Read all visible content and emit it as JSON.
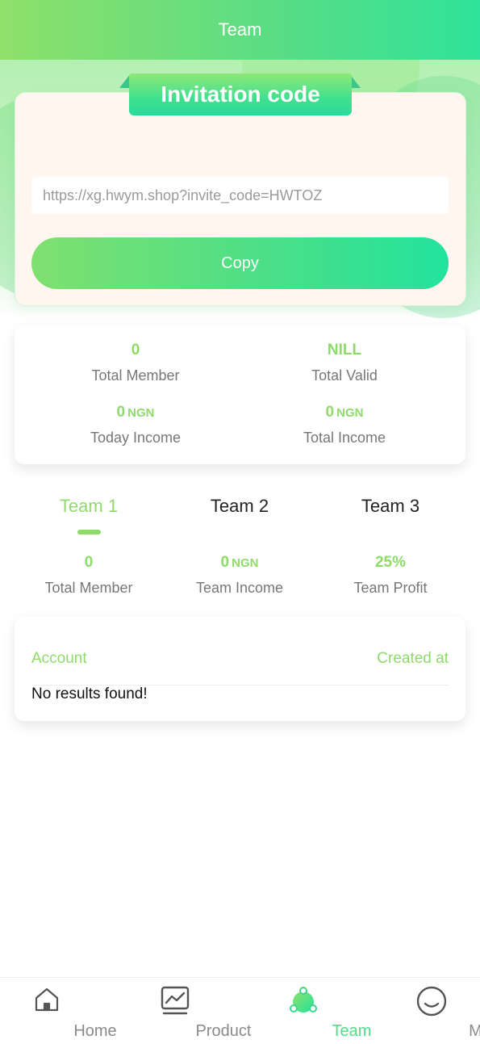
{
  "header": {
    "title": "Team"
  },
  "invite": {
    "title": "Invitation code",
    "link": "https://xg.hwym.shop?invite_code=HWTOZ",
    "copy_label": "Copy"
  },
  "stats": {
    "total_member": {
      "value": "0",
      "label": "Total Member"
    },
    "total_valid": {
      "value": "NILL",
      "label": "Total Valid"
    },
    "today_income": {
      "value": "0",
      "unit": "NGN",
      "label": "Today Income"
    },
    "total_income": {
      "value": "0",
      "unit": "NGN",
      "label": "Total Income"
    }
  },
  "tabs": [
    {
      "label": "Team 1",
      "active": true
    },
    {
      "label": "Team 2",
      "active": false
    },
    {
      "label": "Team 3",
      "active": false
    }
  ],
  "team_stats": {
    "member": {
      "value": "0",
      "label": "Total Member"
    },
    "income": {
      "value": "0",
      "unit": "NGN",
      "label": "Team Income"
    },
    "profit": {
      "value": "25%",
      "label": "Team Profit"
    }
  },
  "list": {
    "col_account": "Account",
    "col_created": "Created at",
    "empty": "No results found!"
  },
  "nav": [
    {
      "label": "Home",
      "icon": "home-icon",
      "active": false
    },
    {
      "label": "Product",
      "icon": "chart-icon",
      "active": false
    },
    {
      "label": "Team",
      "icon": "team-icon",
      "active": true
    },
    {
      "label": "Me",
      "icon": "profile-icon",
      "active": false
    }
  ],
  "colors": {
    "accent": "#8edb6b",
    "gradient_start": "#8ee06a",
    "gradient_end": "#2fe39a",
    "nav_active": "#4ddf87"
  }
}
